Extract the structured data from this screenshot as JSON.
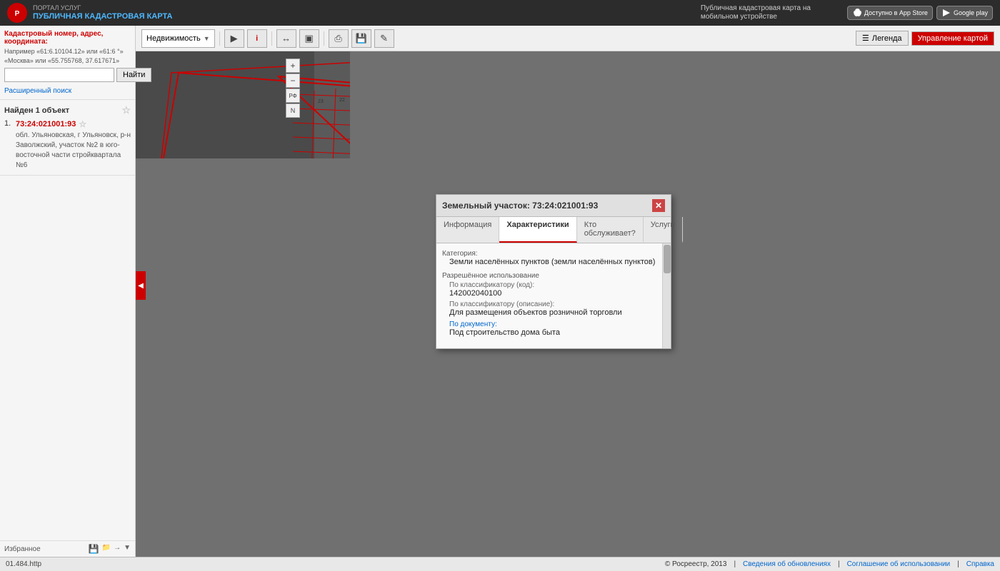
{
  "header": {
    "portal_label": "ПОРТАЛ УСЛУГ",
    "title": "ПУБЛИЧНАЯ КАДАСТРОВАЯ КАРТА",
    "mobile_label": "Публичная кадастровая карта на мобильном устройстве",
    "appstore_label": "Доступно в App Store",
    "googleplay_label": "Google play"
  },
  "toolbar": {
    "dropdown_label": "Недвижимость",
    "legend_label": "Легенда",
    "manage_map_label": "Управление картой"
  },
  "search": {
    "label": "Кадастровый номер, адрес, координата:",
    "hint_line1": "Например «61:6.10104.12» или «61:6 °»",
    "hint_line2": "«Москва» или «55.755768, 37.617671»",
    "button_label": "Найти",
    "placeholder": "",
    "advanced_label": "Расширенный поиск"
  },
  "results": {
    "label": "Найден 1 объект",
    "items": [
      {
        "number": "1.",
        "cadastral": "73:24:021001:93",
        "address": "обл. Ульяновская, г Ульяновск, р-н Заволжский, участок №2 в юго-восточной части стройквартала №6"
      }
    ]
  },
  "favorites": {
    "label": "Избранное"
  },
  "popup": {
    "title": "Земельный участок: 73:24:021001:93",
    "tabs": [
      "Информация",
      "Характеристики",
      "Кто обслуживает?",
      "Услуги"
    ],
    "active_tab": "Характеристики",
    "fields": {
      "category_label": "Категория:",
      "category_value": "Земли населённых пунктов (земли населённых пунктов)",
      "usage_label": "Разрешённое использование",
      "usage_code_label": "По классификатору (код):",
      "usage_code_value": "142002040100",
      "usage_desc_label": "По классификатору (описание):",
      "usage_desc_value": "Для размещения объектов розничной торговли",
      "usage_doc_label": "По документу:",
      "usage_doc_value": "Под строительство дома быта"
    }
  },
  "status": {
    "url": "01.484.http",
    "copyright": "© Росреестр, 2013",
    "links": [
      "Сведения об обновлениях",
      "Соглашение об использовании",
      "Справка"
    ]
  },
  "icons": {
    "search": "🔍",
    "star_empty": "☆",
    "star_filled": "★",
    "close": "✕",
    "arrow_left": "◀",
    "arrow_down": "▼",
    "plus": "+",
    "minus": "−",
    "layers": "⊞",
    "ruler": "⌖",
    "print": "⎙",
    "download": "↓",
    "pencil": "✎",
    "legend": "≡",
    "settings": "⚙"
  }
}
